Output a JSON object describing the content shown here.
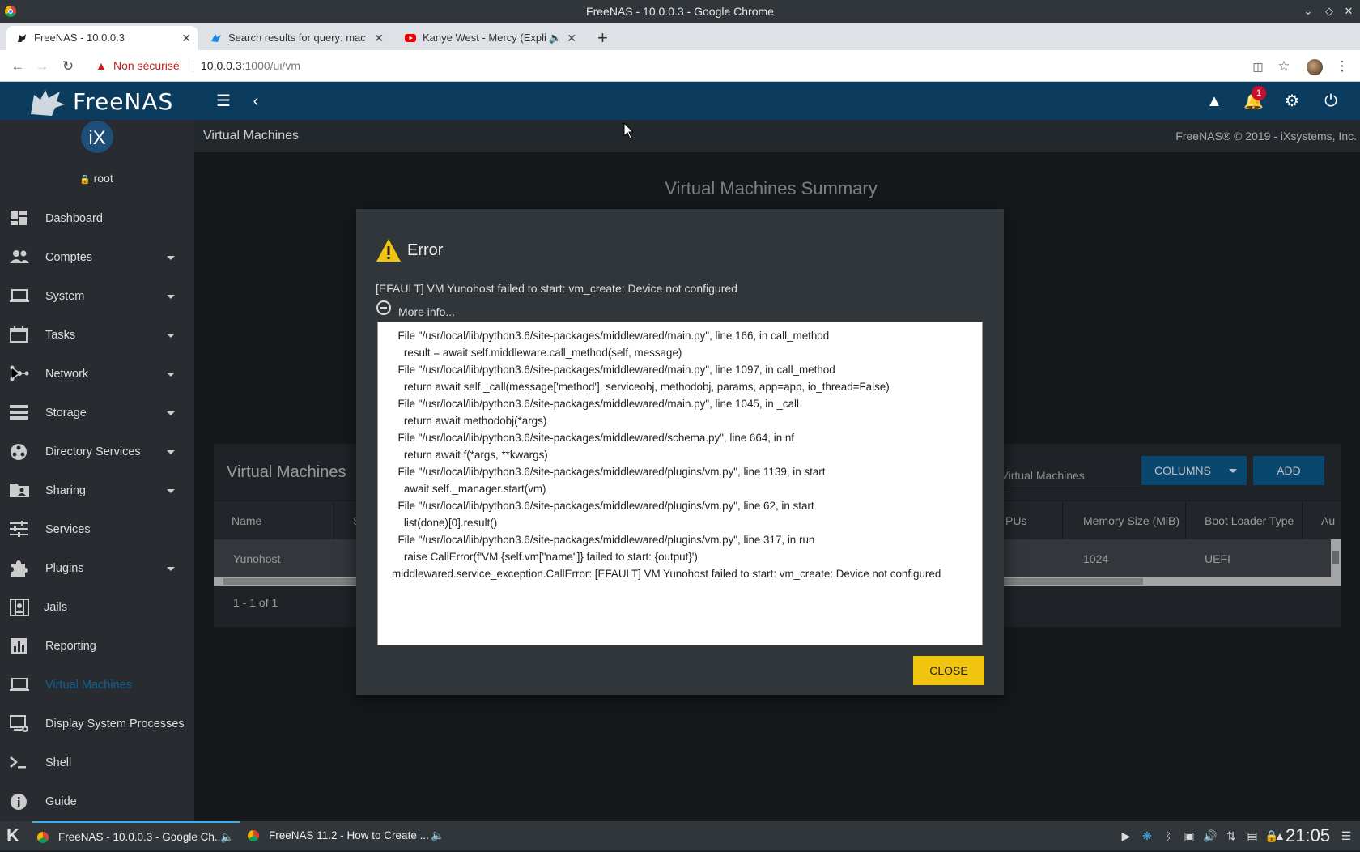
{
  "window": {
    "title": "FreeNAS - 10.0.0.3 - Google Chrome"
  },
  "tabs": [
    {
      "label": "FreeNAS - 10.0.0.3",
      "active": true
    },
    {
      "label": "Search results for query: mac",
      "active": false
    },
    {
      "label": "Kanye West - Mercy (Expli",
      "active": false
    }
  ],
  "addressbar": {
    "security": "Non sécurisé",
    "host": "10.0.0.3",
    "path": ":1000/ui/vm"
  },
  "app": {
    "brand": "FreeNAS",
    "ix_logo": "iX",
    "user": "root",
    "notification_count": "1",
    "page_title": "Virtual Machines",
    "copyright": "FreeNAS® © 2019 - iXsystems, Inc."
  },
  "sidebar": {
    "items": [
      {
        "label": "Dashboard",
        "icon": "dashboard-icon",
        "expandable": false
      },
      {
        "label": "Comptes",
        "icon": "people-icon",
        "expandable": true
      },
      {
        "label": "System",
        "icon": "laptop-icon",
        "expandable": true
      },
      {
        "label": "Tasks",
        "icon": "calendar-icon",
        "expandable": true
      },
      {
        "label": "Network",
        "icon": "network-icon",
        "expandable": true
      },
      {
        "label": "Storage",
        "icon": "storage-icon",
        "expandable": true
      },
      {
        "label": "Directory Services",
        "icon": "directory-icon",
        "expandable": true
      },
      {
        "label": "Sharing",
        "icon": "folder-shared-icon",
        "expandable": true
      },
      {
        "label": "Services",
        "icon": "tune-icon",
        "expandable": false
      },
      {
        "label": "Plugins",
        "icon": "extension-icon",
        "expandable": true
      },
      {
        "label": "Jails",
        "icon": "jail-icon",
        "expandable": false
      },
      {
        "label": "Reporting",
        "icon": "chart-icon",
        "expandable": false
      },
      {
        "label": "Virtual Machines",
        "icon": "computer-icon",
        "expandable": false,
        "active": true
      },
      {
        "label": "Display System Processes",
        "icon": "settings-app-icon",
        "expandable": false
      },
      {
        "label": "Shell",
        "icon": "console-icon",
        "expandable": false
      },
      {
        "label": "Guide",
        "icon": "info-icon",
        "expandable": false
      }
    ]
  },
  "summary": {
    "title": "Virtual Machines Summary"
  },
  "vm_table": {
    "title": "Virtual Machines",
    "search_placeholder": "r Virtual Machines",
    "columns_button": "COLUMNS",
    "add_button": "ADD",
    "headers": [
      "Name",
      "S",
      "PUs",
      "Memory Size (MiB)",
      "Boot Loader Type",
      "Au"
    ],
    "rows": [
      {
        "name": "Yunohost",
        "memory": "1024",
        "boot": "UEFI"
      }
    ],
    "pager": "1 - 1 of 1"
  },
  "dialog": {
    "title": "Error",
    "message": "[EFAULT] VM Yunohost failed to start: vm_create: Device not configured",
    "more_info": "More info...",
    "traceback": "  File \"/usr/local/lib/python3.6/site-packages/middlewared/main.py\", line 166, in call_method\n    result = await self.middleware.call_method(self, message)\n  File \"/usr/local/lib/python3.6/site-packages/middlewared/main.py\", line 1097, in call_method\n    return await self._call(message['method'], serviceobj, methodobj, params, app=app, io_thread=False)\n  File \"/usr/local/lib/python3.6/site-packages/middlewared/main.py\", line 1045, in _call\n    return await methodobj(*args)\n  File \"/usr/local/lib/python3.6/site-packages/middlewared/schema.py\", line 664, in nf\n    return await f(*args, **kwargs)\n  File \"/usr/local/lib/python3.6/site-packages/middlewared/plugins/vm.py\", line 1139, in start\n    await self._manager.start(vm)\n  File \"/usr/local/lib/python3.6/site-packages/middlewared/plugins/vm.py\", line 62, in start\n    list(done)[0].result()\n  File \"/usr/local/lib/python3.6/site-packages/middlewared/plugins/vm.py\", line 317, in run\n    raise CallError(f'VM {self.vm[\"name\"]} failed to start: {output}')\nmiddlewared.service_exception.CallError: [EFAULT] VM Yunohost failed to start: vm_create: Device not configured",
    "close_button": "CLOSE"
  },
  "taskbar": {
    "tasks": [
      "FreeNAS - 10.0.0.3 - Google Ch...",
      "FreeNAS 11.2 - How to Create ..."
    ],
    "clock": "21:05"
  },
  "colors": {
    "topbar": "#0b3c5e",
    "accent": "#0d5f93",
    "close_button": "#f1c40f",
    "warning": "#f1c40f"
  }
}
